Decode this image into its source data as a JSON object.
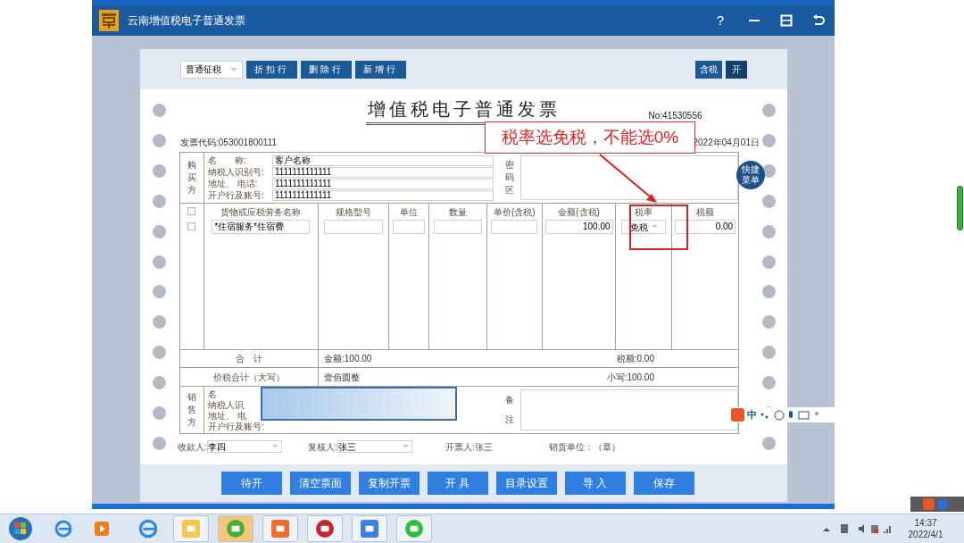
{
  "window": {
    "title": "云南增值税电子普通发票",
    "help": "?"
  },
  "toolbar": {
    "tax_mode": "普通征税",
    "buttons": [
      "折扣行",
      "删除行",
      "新增行"
    ],
    "tax_included": {
      "label": "含税",
      "toggle": "开",
      "on": true
    }
  },
  "invoice": {
    "title": "增值税电子普通发票",
    "number": "No:41530556",
    "code": "发票代码:053001800111",
    "date": "2022年04月01日",
    "buyer": {
      "side_label": "购买方",
      "cipher_label": "密码区",
      "fields": [
        {
          "label": "名　　称:",
          "value": "客户名称"
        },
        {
          "label": "纳税人识别号:",
          "value": "1111111111111"
        },
        {
          "label": "地址、 电话:",
          "value": "1111111111111"
        },
        {
          "label": "开户行及账号:",
          "value": "1111111111111"
        }
      ]
    },
    "columns": [
      "货物或应税劳务名称",
      "规格型号",
      "单位",
      "数量",
      "单价(含税)",
      "金额(含税)",
      "税率",
      "税额"
    ],
    "header_checkbox": {
      "checked": false
    },
    "items": [
      {
        "checked": false,
        "name": "*住宿服务*住宿费",
        "amount": "100.00",
        "tax_rate": "免税",
        "tax": "0.00"
      }
    ],
    "totals": {
      "label": "合　计",
      "amount": "金额:100.00",
      "tax": "税额:0.00"
    },
    "grand_total": {
      "label": "价税合计（大写）",
      "words": "壹佰圆整",
      "figures": "小写:100.00"
    },
    "seller": {
      "side_label": "销售方",
      "labels": [
        "名",
        "纳税人识",
        "地址、 电",
        "开户行及账号:"
      ],
      "remarks_label": "备注"
    },
    "signatures": [
      {
        "kind": "select",
        "label": "收款人:",
        "value": "李四"
      },
      {
        "kind": "select",
        "label": "复核人:",
        "value": "张三"
      },
      {
        "kind": "text",
        "label": "开票人:张三"
      },
      {
        "kind": "text",
        "label": "销货单位：（章）"
      }
    ]
  },
  "quick_menu": "快捷菜单",
  "annotation": {
    "text": "税率选免税，不能选0%"
  },
  "actions": [
    "待开",
    "清空票面",
    "复制开票",
    "开 具",
    "目录设置",
    "导 入",
    "保存"
  ],
  "ime": {
    "label": "中"
  },
  "taskbar": {
    "time": "14:37",
    "date": "2022/4/1"
  }
}
